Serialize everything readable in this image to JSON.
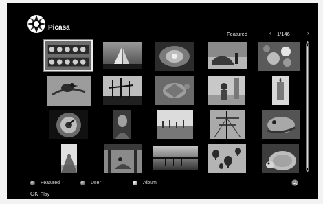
{
  "header": {
    "app_title": "Picasa",
    "category": "Featured",
    "prev_arrow": "‹",
    "next_arrow": "›",
    "page_counter": "1/146"
  },
  "icons": {
    "logo": "picasa-logo-icon",
    "zoom": "magnifier-icon",
    "scroll_up": "triangle-up-icon",
    "scroll_down": "triangle-down-icon"
  },
  "grid": {
    "selected_index": 0,
    "photos": [
      {
        "subject": "ornate carving"
      },
      {
        "subject": "sailboat"
      },
      {
        "subject": "flower close-up"
      },
      {
        "subject": "seaside rocks"
      },
      {
        "subject": "flowers"
      },
      {
        "subject": "bird on branch"
      },
      {
        "subject": "boats silhouette"
      },
      {
        "subject": "sea turtle"
      },
      {
        "subject": "child on beach"
      },
      {
        "subject": "candle"
      },
      {
        "subject": "clock mechanism"
      },
      {
        "subject": "portrait"
      },
      {
        "subject": "trees"
      },
      {
        "subject": "ship mast"
      },
      {
        "subject": "lizard"
      },
      {
        "subject": "road"
      },
      {
        "subject": "man with boat"
      },
      {
        "subject": "pier at sunset"
      },
      {
        "subject": "hot air balloons"
      },
      {
        "subject": "hedgehog"
      }
    ]
  },
  "footer": {
    "featured": "Featured",
    "user": "User",
    "album": "Album",
    "ok_key": "OK",
    "ok_action": "Play"
  },
  "colors": {
    "screen": "#000000",
    "text": "#dcdcdc",
    "selection": "#ececec"
  }
}
